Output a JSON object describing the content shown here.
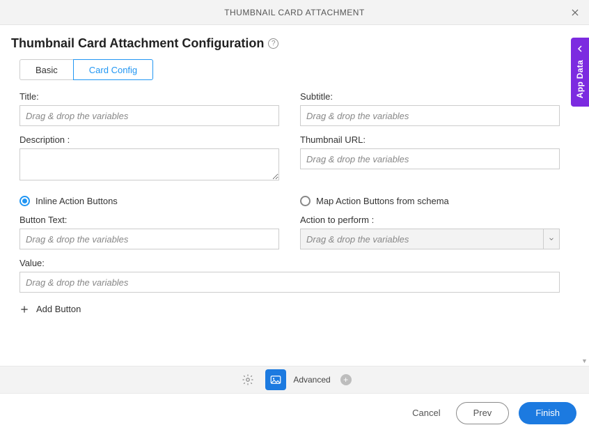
{
  "header": {
    "title": "THUMBNAIL CARD ATTACHMENT"
  },
  "page": {
    "title": "Thumbnail Card Attachment Configuration"
  },
  "tabs": {
    "basic": "Basic",
    "cardConfig": "Card Config"
  },
  "fields": {
    "title": {
      "label": "Title:",
      "placeholder": "Drag & drop the variables"
    },
    "subtitle": {
      "label": "Subtitle:",
      "placeholder": "Drag & drop the variables"
    },
    "description": {
      "label": "Description :"
    },
    "thumbnailUrl": {
      "label": "Thumbnail URL:",
      "placeholder": "Drag & drop the variables"
    },
    "buttonText": {
      "label": "Button Text:",
      "placeholder": "Drag & drop the variables"
    },
    "action": {
      "label": "Action to perform :",
      "placeholder": "Drag & drop the variables"
    },
    "value": {
      "label": "Value:",
      "placeholder": "Drag & drop the variables"
    }
  },
  "radios": {
    "inline": "Inline Action Buttons",
    "map": "Map Action Buttons from schema"
  },
  "add": {
    "label": "Add Button"
  },
  "side": {
    "label": "App Data"
  },
  "toolbar": {
    "advanced": "Advanced"
  },
  "footer": {
    "cancel": "Cancel",
    "prev": "Prev",
    "finish": "Finish"
  }
}
